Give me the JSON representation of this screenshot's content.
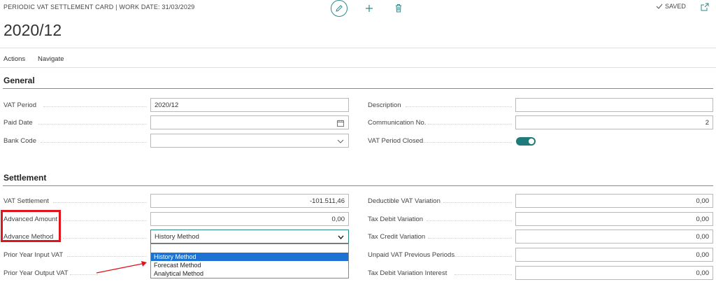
{
  "header": {
    "breadcrumb": "PERIODIC VAT SETTLEMENT CARD | WORK DATE: 31/03/2029",
    "saved_label": "SAVED",
    "title": "2020/12"
  },
  "menu": {
    "actions": "Actions",
    "navigate": "Navigate"
  },
  "general": {
    "title": "General",
    "vat_period_label": "VAT Period",
    "vat_period_value": "2020/12",
    "paid_date_label": "Paid Date",
    "bank_code_label": "Bank Code",
    "description_label": "Description",
    "communication_label": "Communication No.",
    "communication_value": "2",
    "vat_period_closed_label": "VAT Period Closed",
    "vat_period_closed_value": true
  },
  "settlement": {
    "title": "Settlement",
    "vat_settlement_label": "VAT Settlement",
    "vat_settlement_value": "-101.511,46",
    "advanced_amount_label": "Advanced Amount",
    "advanced_amount_value": "0,00",
    "advance_method_label": "Advance Method",
    "advance_method_value": "History Method",
    "advance_method_options": [
      "",
      "History Method",
      "Forecast Method",
      "Analytical Method"
    ],
    "prior_input_label": "Prior Year Input VAT",
    "prior_output_label": "Prior Year Output VAT",
    "deductible_label": "Deductible VAT Variation",
    "deductible_value": "0,00",
    "tax_debit_label": "Tax Debit Variation",
    "tax_debit_value": "0,00",
    "tax_credit_label": "Tax Credit Variation",
    "tax_credit_value": "0,00",
    "unpaid_label": "Unpaid VAT Previous Periods",
    "unpaid_value": "0,00",
    "tax_debit_interest_label": "Tax Debit Variation Interest",
    "tax_debit_interest_value": "0,00"
  },
  "colors": {
    "accent": "#2b8a8a",
    "toggle_on": "#1f7a7a",
    "highlight_red": "#e0141b",
    "selection_blue": "#1e73d2"
  },
  "icons": [
    "edit-icon",
    "add-icon",
    "delete-icon",
    "checkmark-icon",
    "popout-icon",
    "calendar-icon",
    "chevron-down-icon"
  ]
}
